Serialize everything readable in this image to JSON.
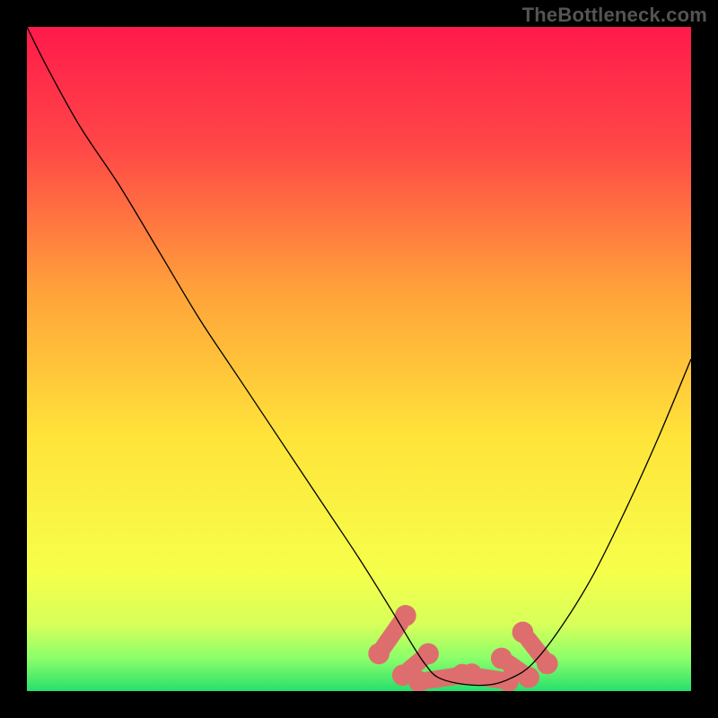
{
  "watermark": {
    "text": "TheBottleneck.com"
  },
  "chart_data": {
    "type": "line",
    "title": "",
    "xlabel": "",
    "ylabel": "",
    "xlim": [
      0,
      100
    ],
    "ylim": [
      0,
      100
    ],
    "grid": false,
    "legend": false,
    "background": {
      "kind": "vertical-gradient",
      "stops": [
        {
          "offset": 0.0,
          "color": "#ff1a4b"
        },
        {
          "offset": 0.18,
          "color": "#ff4747"
        },
        {
          "offset": 0.4,
          "color": "#ffa33a"
        },
        {
          "offset": 0.62,
          "color": "#ffe43a"
        },
        {
          "offset": 0.82,
          "color": "#f6ff4a"
        },
        {
          "offset": 0.9,
          "color": "#d7ff5a"
        },
        {
          "offset": 0.95,
          "color": "#8cff6a"
        },
        {
          "offset": 1.0,
          "color": "#27e06b"
        }
      ]
    },
    "series": [
      {
        "name": "bottleneck-curve",
        "stroke": "#000000",
        "stroke_width": 1.3,
        "x": [
          0,
          3,
          8,
          14,
          20,
          26,
          32,
          38,
          44,
          50,
          55,
          58,
          60,
          62,
          66,
          70,
          73,
          76,
          80,
          85,
          90,
          95,
          100
        ],
        "y": [
          100,
          94,
          85,
          76,
          66,
          56,
          47,
          38,
          29,
          20,
          12,
          7,
          4,
          2,
          1,
          1,
          2,
          4,
          9,
          17,
          27,
          38,
          50
        ]
      }
    ],
    "flat_band": {
      "name": "optimal-range",
      "color": "#de6e6e",
      "opacity": 1.0,
      "segments": [
        {
          "cx": 55.0,
          "cy": 8.5,
          "len": 7,
          "angle": -55
        },
        {
          "cx": 58.5,
          "cy": 4.0,
          "len": 5,
          "angle": -40
        },
        {
          "cx": 63.0,
          "cy": 2.0,
          "len": 8,
          "angle": -8
        },
        {
          "cx": 69.0,
          "cy": 2.0,
          "len": 7,
          "angle": 8
        },
        {
          "cx": 73.5,
          "cy": 3.5,
          "len": 5,
          "angle": 35
        },
        {
          "cx": 76.5,
          "cy": 6.5,
          "len": 6,
          "angle": 52
        }
      ],
      "cap_rx": 1.6,
      "cap_ry": 1.6,
      "body_ry": 1.3
    }
  }
}
